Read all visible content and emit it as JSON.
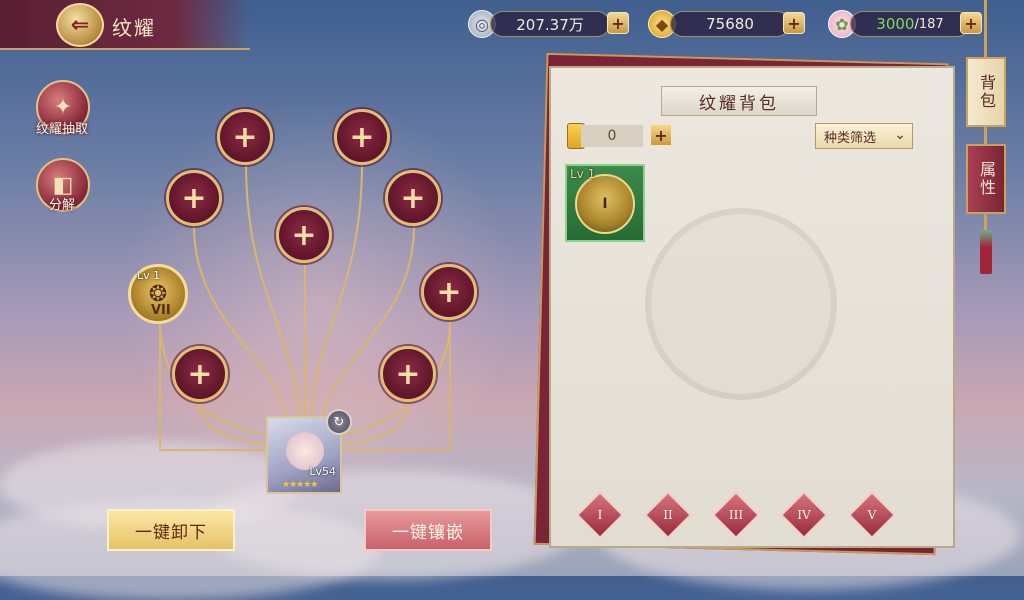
{
  "header": {
    "title": "纹耀",
    "back_icon": "back-arrow-icon"
  },
  "currencies": [
    {
      "name": "silver",
      "icon": "silver-coin-icon",
      "value": "207.37万"
    },
    {
      "name": "gold",
      "icon": "gold-ingot-icon",
      "value": "75680"
    },
    {
      "name": "stamina",
      "icon": "lotus-icon",
      "value_current": "3000",
      "value_max": "/187",
      "current_color": "#7ddc5a"
    }
  ],
  "side_buttons": [
    {
      "label": "纹耀抽取",
      "icon": "draw-icon"
    },
    {
      "label": "分解",
      "icon": "decompose-icon"
    }
  ],
  "slots": {
    "empty_symbol": "+",
    "equipped_gem": {
      "lv": "Lv 1",
      "rank": "VII"
    }
  },
  "hero": {
    "level": "Lv54",
    "stars": "★★★★★"
  },
  "actions": {
    "unequip_all": "一键卸下",
    "equip_all": "一键镶嵌"
  },
  "bag": {
    "title": "纹耀背包",
    "count": "0",
    "filter_label": "种类筛选",
    "items": [
      {
        "lv": "Lv 1"
      }
    ],
    "tiers": [
      "I",
      "II",
      "III",
      "IV",
      "V"
    ]
  },
  "tabs": [
    {
      "label": "背包",
      "active": true
    },
    {
      "label": "属性",
      "active": false
    }
  ],
  "colors": {
    "accent_gold": "#e1bd76",
    "panel_red": "#7a2436"
  }
}
